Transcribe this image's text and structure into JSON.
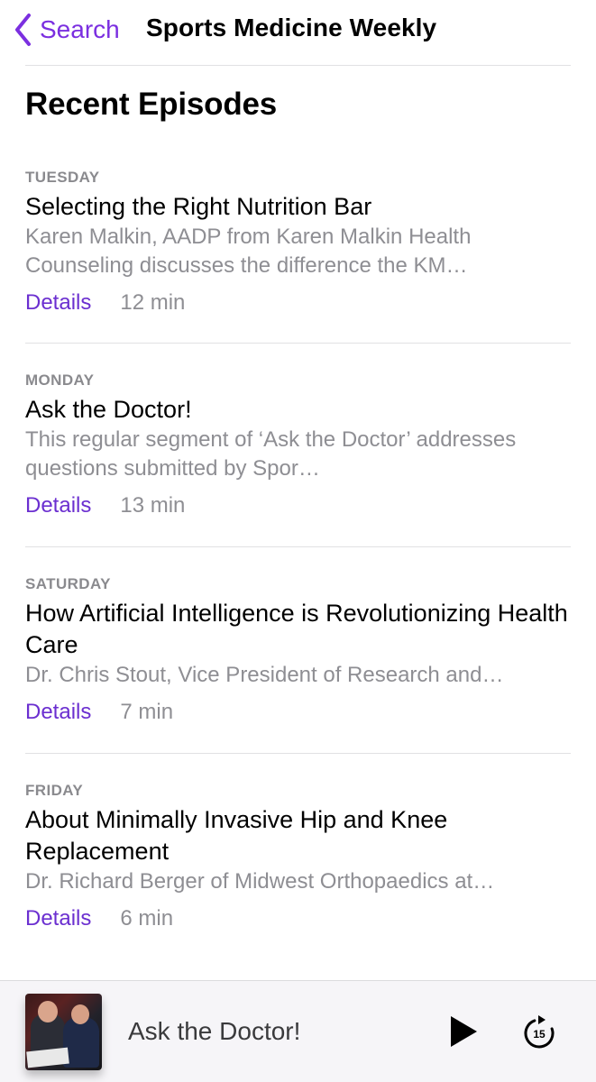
{
  "nav": {
    "back_label": "Search",
    "title": "Sports Medicine Weekly"
  },
  "section_title": "Recent Episodes",
  "episodes": [
    {
      "day": "TUESDAY",
      "title": "Selecting the Right Nutrition Bar",
      "description": "Karen Malkin, AADP from Karen Malkin Health Counseling discusses the difference the KM…",
      "details_label": "Details",
      "duration": "12 min"
    },
    {
      "day": "MONDAY",
      "title": "Ask the Doctor!",
      "description": "This regular segment of ‘Ask the Doctor’ addresses questions submitted by Spor…",
      "details_label": "Details",
      "duration": "13 min"
    },
    {
      "day": "SATURDAY",
      "title": "How Artificial Intelligence is Revolutionizing Health Care",
      "description": "Dr. Chris Stout, Vice President of Research and…",
      "details_label": "Details",
      "duration": "7 min"
    },
    {
      "day": "FRIDAY",
      "title": "About Minimally Invasive Hip and Knee Replacement",
      "description": "Dr. Richard Berger of Midwest Orthopaedics at…",
      "details_label": "Details",
      "duration": "6 min"
    }
  ],
  "mini_player": {
    "title": "Ask the Doctor!",
    "play_icon": "play-icon",
    "skip_icon": "skip-forward-15-icon",
    "skip_seconds": "15"
  },
  "colors": {
    "accent": "#6b2fd0",
    "secondary_text": "#8e8e93",
    "separator": "#e1e1e3"
  }
}
